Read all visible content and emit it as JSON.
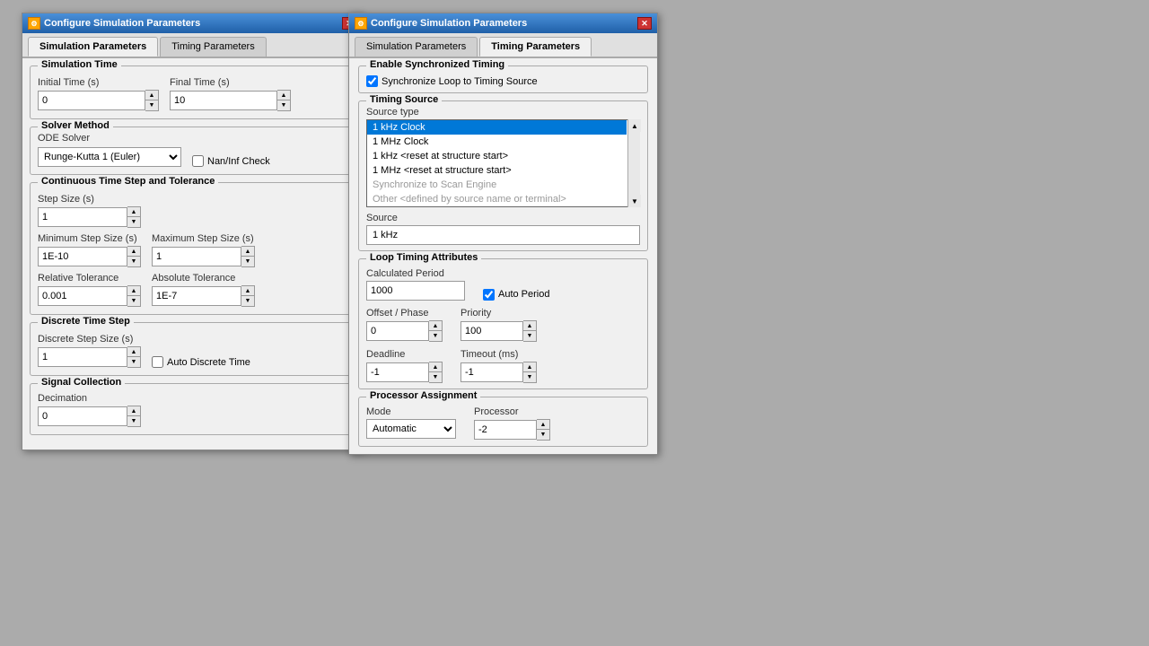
{
  "window1": {
    "title": "Configure Simulation Parameters",
    "tabs": [
      {
        "label": "Simulation Parameters",
        "active": true
      },
      {
        "label": "Timing Parameters",
        "active": false
      }
    ],
    "simulationTime": {
      "groupLabel": "Simulation Time",
      "initialTimeLabel": "Initial Time (s)",
      "initialTimeValue": "0",
      "finalTimeLabel": "Final Time (s)",
      "finalTimeValue": "10"
    },
    "solverMethod": {
      "groupLabel": "Solver Method",
      "odeLabel": "ODE Solver",
      "odeValue": "Runge-Kutta 1 (Euler)",
      "nanInfLabel": "Nan/Inf Check"
    },
    "continuousTimeStep": {
      "groupLabel": "Continuous Time Step and Tolerance",
      "stepSizeLabel": "Step Size (s)",
      "stepSizeValue": "1",
      "minStepLabel": "Minimum Step Size (s)",
      "minStepValue": "1E-10",
      "maxStepLabel": "Maximum Step Size (s)",
      "maxStepValue": "1",
      "relTolLabel": "Relative Tolerance",
      "relTolValue": "0.001",
      "absTolLabel": "Absolute Tolerance",
      "absTolValue": "1E-7"
    },
    "discreteTimeStep": {
      "groupLabel": "Discrete Time Step",
      "stepSizeLabel": "Discrete Step Size (s)",
      "stepSizeValue": "1",
      "autoLabel": "Auto Discrete Time"
    },
    "signalCollection": {
      "groupLabel": "Signal Collection",
      "decimationLabel": "Decimation",
      "decimationValue": "0"
    }
  },
  "window2": {
    "title": "Configure Simulation Parameters",
    "tabs": [
      {
        "label": "Simulation Parameters",
        "active": false
      },
      {
        "label": "Timing Parameters",
        "active": true
      }
    ],
    "enableSync": {
      "groupLabel": "Enable Synchronized Timing",
      "checkLabel": "Synchronize Loop to Timing Source"
    },
    "timingSource": {
      "groupLabel": "Timing Source",
      "sourceTypeLabel": "Source type",
      "options": [
        {
          "label": "1 kHz Clock",
          "selected": true,
          "disabled": false
        },
        {
          "label": "1 MHz Clock",
          "selected": false,
          "disabled": false
        },
        {
          "label": "1 kHz <reset at structure start>",
          "selected": false,
          "disabled": false
        },
        {
          "label": "1 MHz <reset at structure start>",
          "selected": false,
          "disabled": false
        },
        {
          "label": "Synchronize to Scan Engine",
          "selected": false,
          "disabled": true
        },
        {
          "label": "Other <defined by source name or terminal>",
          "selected": false,
          "disabled": true
        }
      ],
      "sourceLabel": "Source",
      "sourceValue": "1 kHz"
    },
    "loopTiming": {
      "groupLabel": "Loop Timing Attributes",
      "calcPeriodLabel": "Calculated Period",
      "calcPeriodValue": "1000",
      "autoPeriodLabel": "Auto Period",
      "autoPeriodChecked": true,
      "offsetPhaseLabel": "Offset / Phase",
      "offsetPhaseValue": "0",
      "priorityLabel": "Priority",
      "priorityValue": "100",
      "deadlineLabel": "Deadline",
      "deadlineValue": "-1",
      "timeoutLabel": "Timeout (ms)",
      "timeoutValue": "-1"
    },
    "processorAssignment": {
      "groupLabel": "Processor Assignment",
      "modeLabel": "Mode",
      "modeValue": "Automatic",
      "processorLabel": "Processor",
      "processorValue": "-2"
    }
  }
}
